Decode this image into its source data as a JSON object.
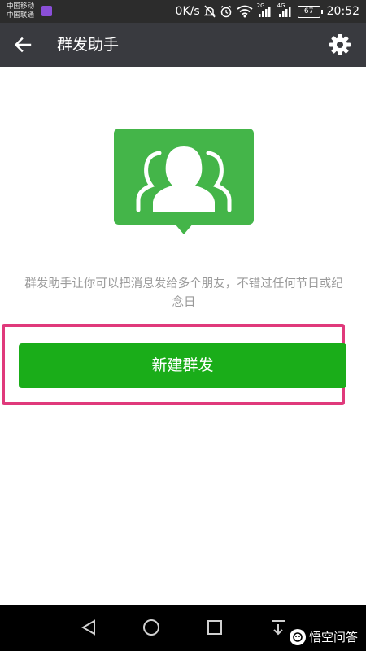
{
  "status_bar": {
    "carrier_1": "中国移动",
    "carrier_2": "中国联通",
    "network_speed": "0K/s",
    "signal_1_label": "2G",
    "signal_2_label": "4G",
    "battery_level": "67",
    "time": "20:52"
  },
  "app_bar": {
    "title": "群发助手",
    "back_icon": "arrow-left-icon",
    "settings_icon": "gear-icon"
  },
  "main": {
    "hero_icon": "group-people-icon",
    "description": "群发助手让你可以把消息发给多个朋友，不错过任何节日或纪念日",
    "primary_button_label": "新建群发"
  },
  "nav_bar": {
    "back_icon": "triangle-back-icon",
    "home_icon": "circle-home-icon",
    "recents_icon": "square-recents-icon",
    "notifications_icon": "pull-down-icon",
    "watermark_text": "悟空问答"
  },
  "colors": {
    "status_bar_bg": "#2c2c2c",
    "app_bar_bg": "#393a3f",
    "hero_green": "#44b549",
    "button_green": "#1aad19",
    "highlight_pink": "#e0397b",
    "description_text": "#9a9a9a"
  }
}
